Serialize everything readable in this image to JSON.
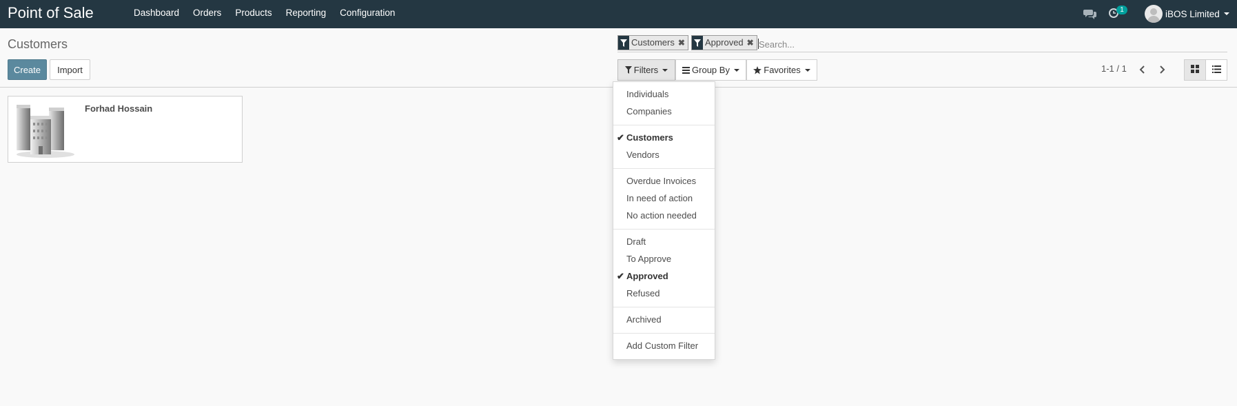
{
  "app": {
    "title": "Point of Sale"
  },
  "menu": [
    "Dashboard",
    "Orders",
    "Products",
    "Reporting",
    "Configuration"
  ],
  "systray": {
    "activity_count": "1",
    "user_name": "iBOS Limited"
  },
  "breadcrumb": "Customers",
  "buttons": {
    "create": "Create",
    "import": "Import"
  },
  "search": {
    "facets": [
      {
        "label": "Customers"
      },
      {
        "label": "Approved"
      }
    ],
    "placeholder": "Search..."
  },
  "search_options": {
    "filters": "Filters",
    "group_by": "Group By",
    "favorites": "Favorites"
  },
  "pager": "1-1 / 1",
  "records": [
    {
      "name": "Forhad Hossain"
    }
  ],
  "filters_menu": {
    "groups": [
      [
        {
          "label": "Individuals",
          "checked": false
        },
        {
          "label": "Companies",
          "checked": false
        }
      ],
      [
        {
          "label": "Customers",
          "checked": true
        },
        {
          "label": "Vendors",
          "checked": false
        }
      ],
      [
        {
          "label": "Overdue Invoices",
          "checked": false
        },
        {
          "label": "In need of action",
          "checked": false
        },
        {
          "label": "No action needed",
          "checked": false
        }
      ],
      [
        {
          "label": "Draft",
          "checked": false
        },
        {
          "label": "To Approve",
          "checked": false
        },
        {
          "label": "Approved",
          "checked": true
        },
        {
          "label": "Refused",
          "checked": false
        }
      ],
      [
        {
          "label": "Archived",
          "checked": false
        }
      ],
      [
        {
          "label": "Add Custom Filter",
          "checked": false
        }
      ]
    ]
  },
  "colors": {
    "navbar": "#243742",
    "primary": "#5b899e",
    "badge": "#00a09d"
  }
}
